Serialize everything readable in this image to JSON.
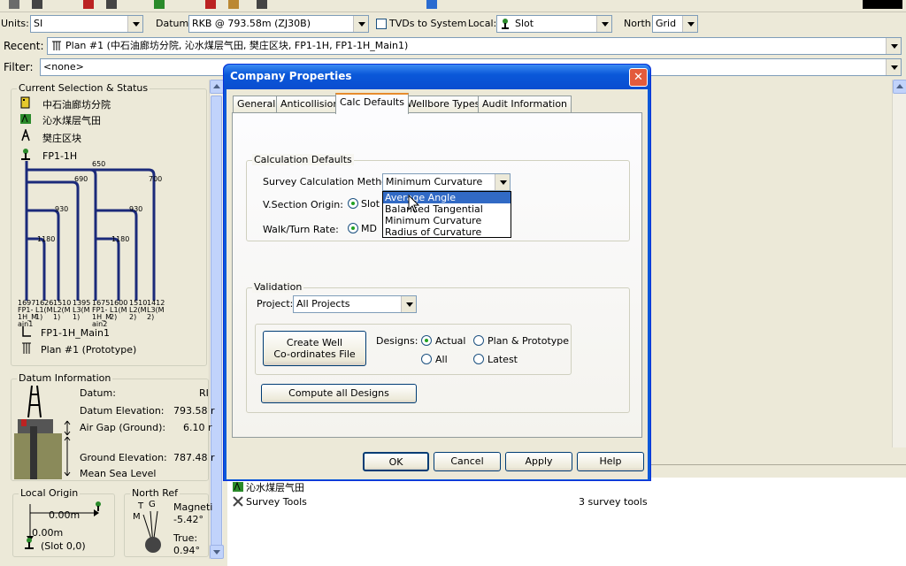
{
  "units": {
    "label": "Units:",
    "value": "SI"
  },
  "datum": {
    "label": "Datum:",
    "value": "RKB @ 793.58m (ZJ30B)"
  },
  "tvd_to_system": {
    "label": "TVDs to System"
  },
  "local": {
    "label": "Local:",
    "value": "Slot"
  },
  "north": {
    "label": "North:",
    "value": "Grid"
  },
  "recent": {
    "label": "Recent:",
    "value": "Plan #1 (中石油廊坊分院, 沁水煤层气田, 樊庄区块, FP1-1H, FP1-1H_Main1)"
  },
  "filter": {
    "label": "Filter:",
    "value": "<none>"
  },
  "selection": {
    "title": "Current Selection & Status",
    "company": "中石油廊坊分院",
    "field": "沁水煤层气田",
    "site": "樊庄区块",
    "well": "FP1-1H",
    "wellbore": "FP1-1H_Main1",
    "plan": "Plan #1 (Prototype)",
    "diagram_numbers": {
      "n650": "650",
      "n690": "690",
      "n700": "700",
      "n930a": "930",
      "n930b": "930",
      "n1180a": "1180",
      "n1180b": "1180"
    },
    "branch_labels": [
      {
        "a": "1697",
        "b": "FP1-",
        "c": "1H_M",
        "d": "ain1"
      },
      {
        "a": "1626",
        "b": "L1(M",
        "c": "1)",
        "d": ""
      },
      {
        "a": "1510",
        "b": "L2(M",
        "c": "1)",
        "d": ""
      },
      {
        "a": "1395",
        "b": "L3(M",
        "c": "1)",
        "d": ""
      },
      {
        "a": "1675",
        "b": "FP1-",
        "c": "1H_M",
        "d": "ain2"
      },
      {
        "a": "1600",
        "b": "L1(M",
        "c": "2)",
        "d": ""
      },
      {
        "a": "1510",
        "b": "L2(M",
        "c": "2)",
        "d": ""
      },
      {
        "a": "1412",
        "b": "L3(M",
        "c": "2)",
        "d": ""
      }
    ]
  },
  "datum_info": {
    "title": "Datum Information",
    "datum_label": "Datum:",
    "datum_value": "RI",
    "elev_label": "Datum Elevation:",
    "elev_value": "793.58 r",
    "gap_label": "Air Gap (Ground):",
    "gap_value": "6.10 r",
    "ground_label": "Ground Elevation:",
    "ground_value": "787.48 r",
    "msl_label": "Mean Sea Level"
  },
  "local_origin": {
    "title": "Local Origin",
    "x": "0.00m",
    "y": "0.00m",
    "slot": "(Slot 0,0)"
  },
  "north_ref": {
    "title": "North Ref",
    "t": "T",
    "g": "G",
    "m": "M",
    "mag_label": "Magneti",
    "mag_value": "-5.42°",
    "true_label": "True:",
    "true_value": "0.94°"
  },
  "bottom_list": [
    {
      "name": "沁水煤层气田",
      "info": ""
    },
    {
      "name": "Survey Tools",
      "info": "3 survey tools"
    }
  ],
  "dialog": {
    "title": "Company Properties",
    "tabs": [
      "General",
      "Anticollision",
      "Calc Defaults",
      "Wellbore Types",
      "Audit Information"
    ],
    "calc_group": "Calculation Defaults",
    "survey_method_label": "Survey Calculation Method",
    "survey_method_value": "Minimum Curvature",
    "survey_options": [
      "Average Angle",
      "Balanced Tangential",
      "Minimum Curvature",
      "Radius of Curvature"
    ],
    "vsection_label": "V.Section Origin:",
    "vsection_value": "Slot",
    "walkturn_label": "Walk/Turn Rate:",
    "walkturn_value": "MD",
    "validation_group": "Validation",
    "project_label": "Project:",
    "project_value": "All Projects",
    "create_well_btn1": "Create Well",
    "create_well_btn2": "Co-ordinates File",
    "designs_label": "Designs:",
    "design_opts": [
      "Actual",
      "Plan & Prototype",
      "All",
      "Latest"
    ],
    "compute_btn": "Compute all Designs",
    "ok": "OK",
    "cancel": "Cancel",
    "apply": "Apply",
    "help": "Help"
  },
  "colors": {
    "title_blue": "#0a58d9",
    "wellpath": "#1b2a7a",
    "highlight": "#316ac5"
  }
}
